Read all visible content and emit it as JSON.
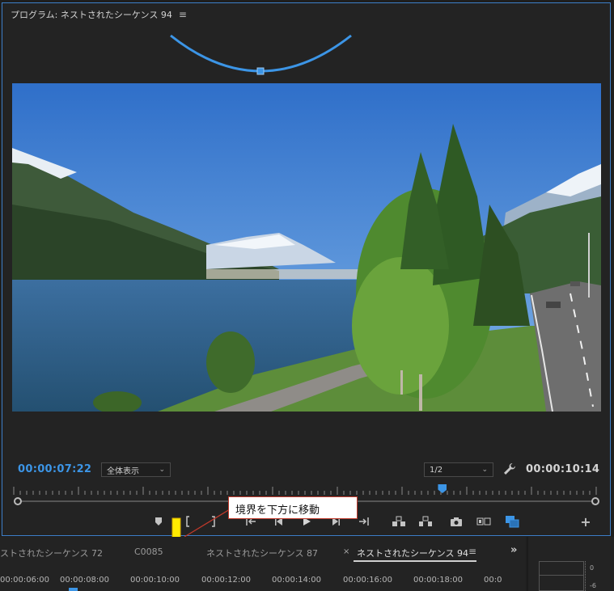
{
  "program_panel": {
    "title": "プログラム: ネストされたシーケンス 94",
    "menu_icon": "hamburger-icon"
  },
  "monitor": {
    "timecode_current": "00:00:07:22",
    "zoom_select": "全体表示",
    "resolution_select": "1/2",
    "timecode_duration": "00:00:10:14",
    "playhead_fraction": 0.73
  },
  "annotation": {
    "callout_text": "境界を下方に移動",
    "arrow_color": "#ffeb00",
    "callout_border": "#c0392b"
  },
  "transport_icons": [
    "add-marker-icon",
    "mark-in-icon",
    "mark-out-icon",
    "go-to-in-icon",
    "step-back-icon",
    "play-icon",
    "step-forward-icon",
    "go-to-out-icon",
    "lift-icon",
    "extract-icon",
    "export-frame-icon",
    "comparison-view-icon",
    "proxy-toggle-icon",
    "add-button-icon"
  ],
  "timeline": {
    "tabs": [
      {
        "label": "ストされたシーケンス 72"
      },
      {
        "label": "C0085"
      },
      {
        "label": "ネストされたシーケンス 87"
      },
      {
        "label": "ネストされたシーケンス 94"
      }
    ],
    "more": "»",
    "ruler": [
      "00:00:06:00",
      "00:00:08:00",
      "00:00:10:00",
      "00:00:12:00",
      "00:00:14:00",
      "00:00:16:00",
      "00:00:18:00",
      "00:0"
    ]
  },
  "meter": {
    "db_top": "0",
    "db_bottom": "-6"
  },
  "colors": {
    "accent": "#3c95e6",
    "panel_bg": "#232323"
  }
}
